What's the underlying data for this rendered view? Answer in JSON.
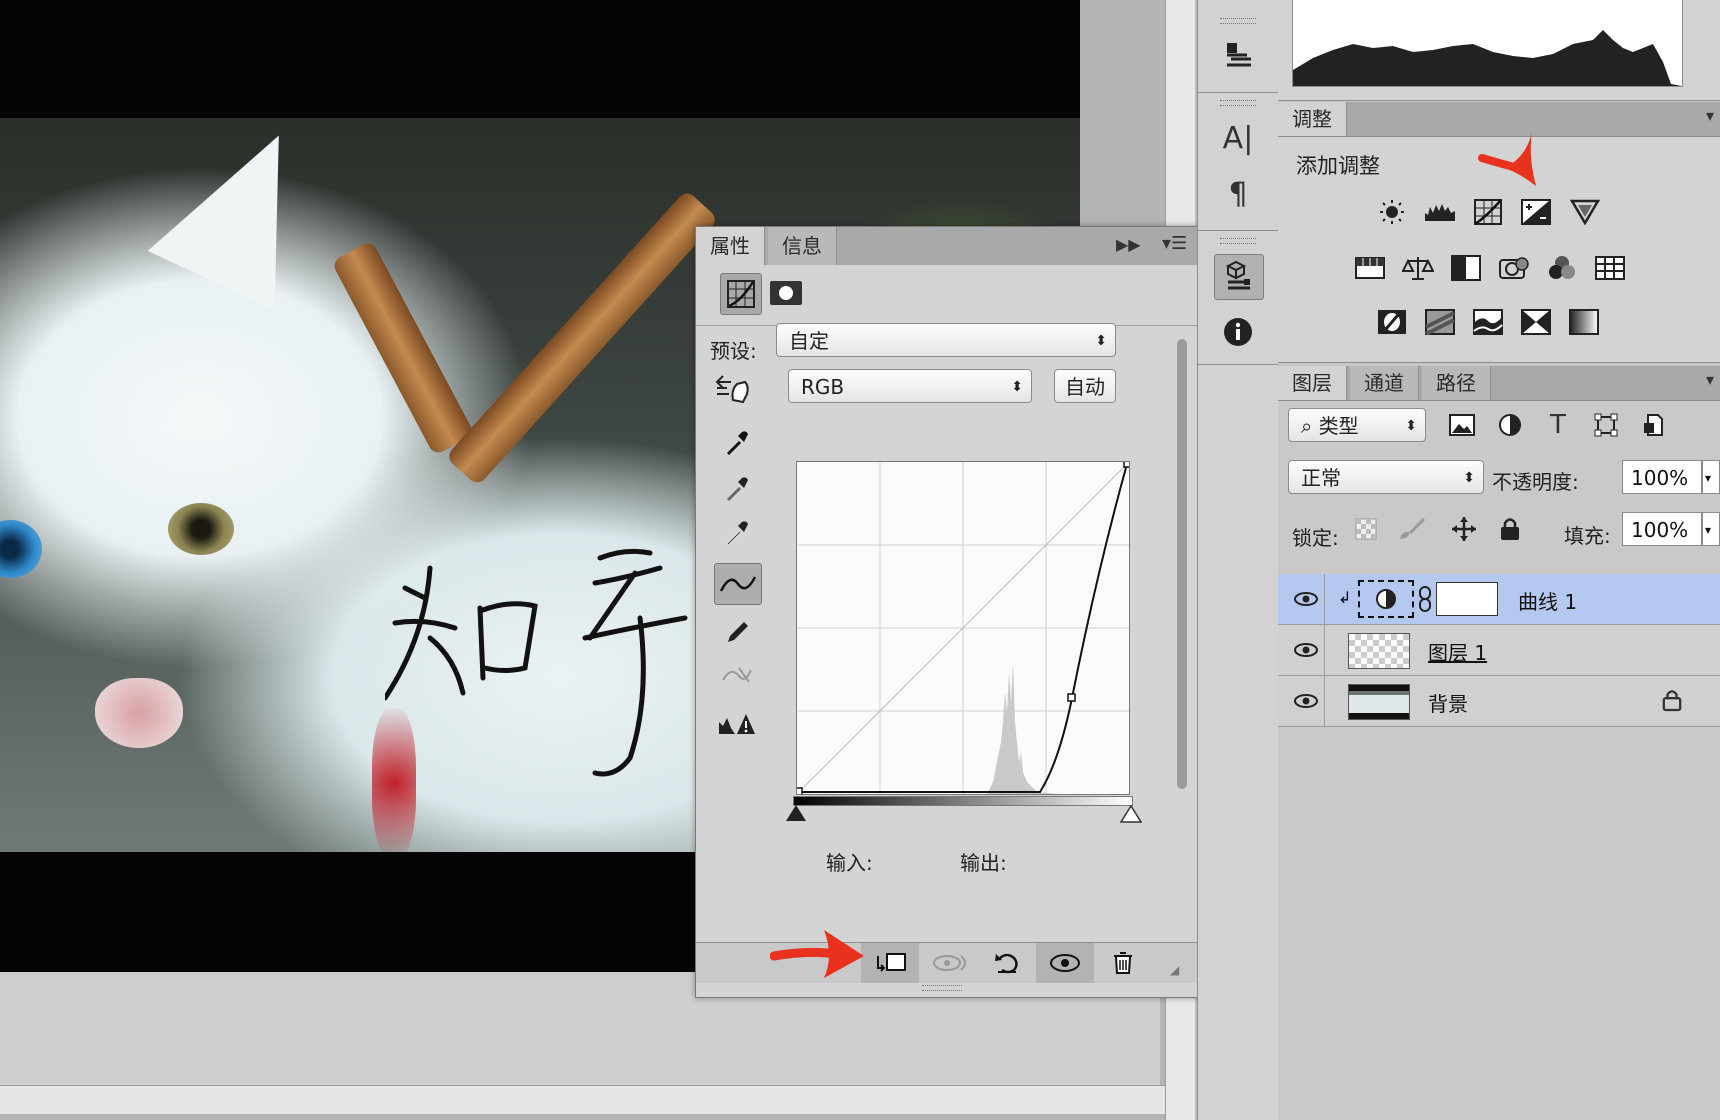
{
  "document": {
    "signature_text": "知乎"
  },
  "properties_panel": {
    "tabs": [
      {
        "label": "属性"
      },
      {
        "label": "信息"
      }
    ],
    "preset_label": "预设:",
    "preset_value": "自定",
    "channel_value": "RGB",
    "auto_button": "自动",
    "input_label": "输入:",
    "output_label": "输出:"
  },
  "adjustments_panel": {
    "tab": "调整",
    "title": "添加调整",
    "icons": [
      "brightness-contrast-icon",
      "levels-icon",
      "curves-icon",
      "exposure-icon",
      "vibrance-icon",
      "hue-saturation-icon",
      "color-balance-icon",
      "black-white-icon",
      "photo-filter-icon",
      "channel-mixer-icon",
      "color-lookup-icon",
      "invert-icon",
      "posterize-icon",
      "threshold-icon",
      "selective-color-icon",
      "gradient-map-icon"
    ]
  },
  "layers_panel": {
    "tabs": [
      {
        "label": "图层"
      },
      {
        "label": "通道"
      },
      {
        "label": "路径"
      }
    ],
    "filter_kind": "类型",
    "blend_mode": "正常",
    "opacity_label": "不透明度:",
    "opacity_value": "100%",
    "lock_label": "锁定:",
    "fill_label": "填充:",
    "fill_value": "100%",
    "layers": [
      {
        "name": "曲线 1",
        "type": "adjustment-curves",
        "selected": true
      },
      {
        "name": "图层 1",
        "type": "pixel-transparent",
        "selected": false
      },
      {
        "name": "背景",
        "type": "background",
        "selected": false,
        "locked": true
      }
    ]
  },
  "colors": {
    "selected_layer": "#b5c8ef",
    "annotation_arrow": "#e8321e"
  }
}
